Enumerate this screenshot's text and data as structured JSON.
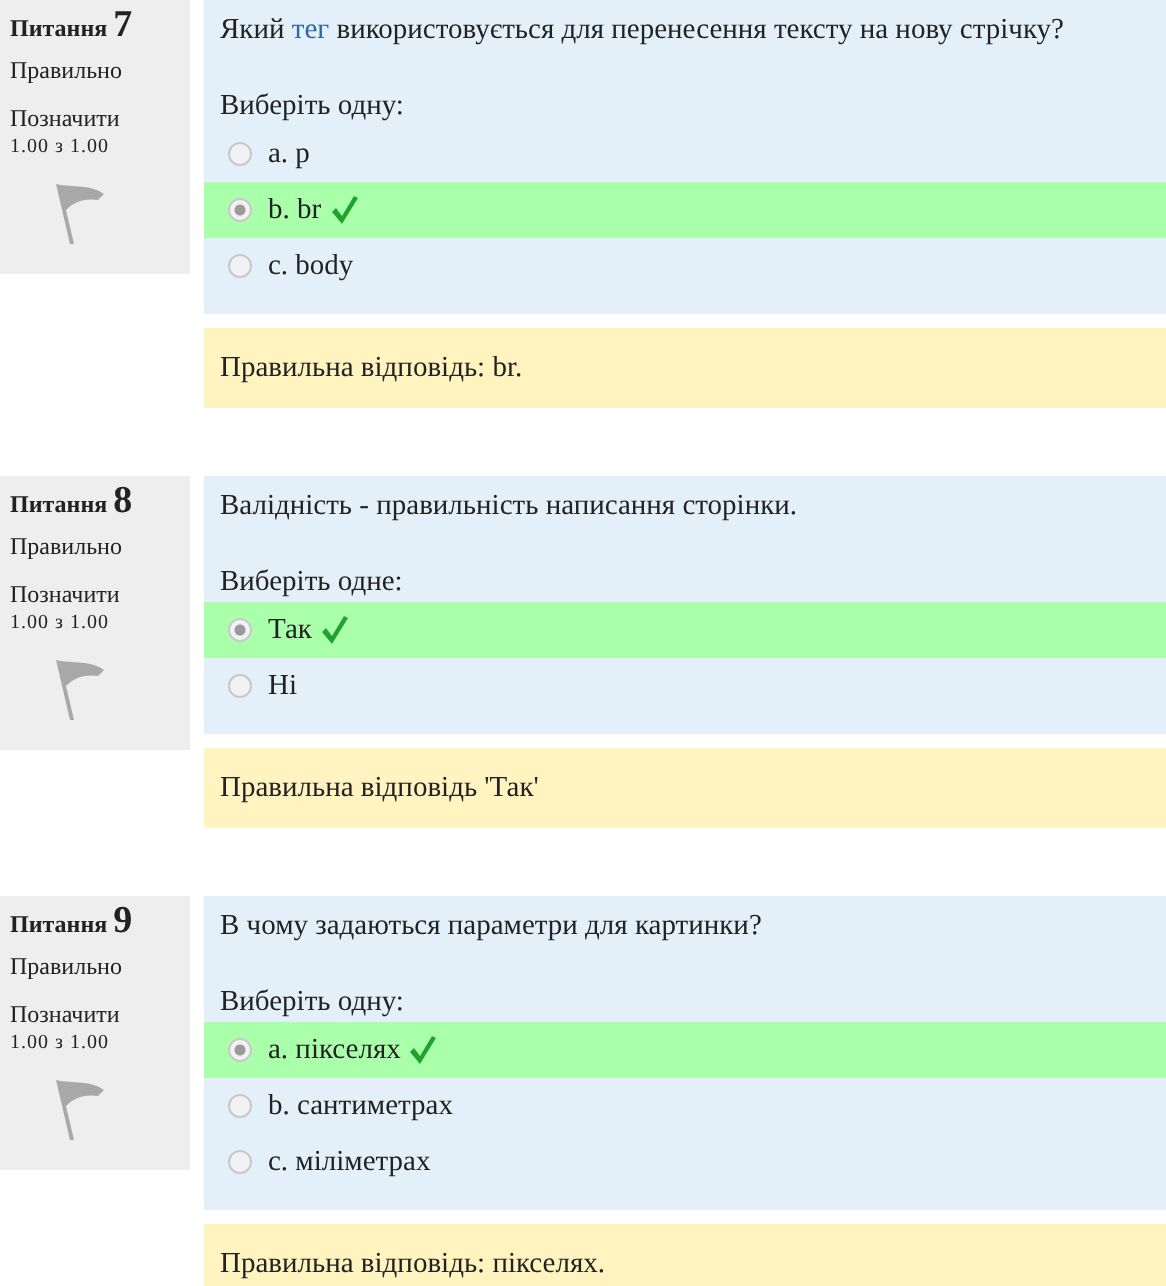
{
  "questions": [
    {
      "label": "Питання",
      "number": "7",
      "status": "Правильно",
      "flag_label": "Позначити",
      "score": "1.00 з 1.00",
      "flagged": false,
      "text": [
        {
          "kind": "plain",
          "text": "Який "
        },
        {
          "kind": "link",
          "text": "тег"
        },
        {
          "kind": "plain",
          "text": " використовується для перенесення тексту на нову стрічку?"
        }
      ],
      "prompt": "Виберіть одну:",
      "options": [
        {
          "text": "a. p",
          "selected": false,
          "correct": false
        },
        {
          "text": "b. br",
          "selected": true,
          "correct": true
        },
        {
          "text": "c. body",
          "selected": false,
          "correct": false
        }
      ],
      "feedback": "Правильна відповідь: br."
    },
    {
      "label": "Питання",
      "number": "8",
      "status": "Правильно",
      "flag_label": "Позначити",
      "score": "1.00 з 1.00",
      "flagged": false,
      "text": [
        {
          "kind": "plain",
          "text": "Валідність - правильність написання сторінки."
        }
      ],
      "prompt": "Виберіть одне:",
      "options": [
        {
          "text": "Так",
          "selected": true,
          "correct": true
        },
        {
          "text": "Ні",
          "selected": false,
          "correct": false
        }
      ],
      "feedback": "Правильна відповідь 'Так'"
    },
    {
      "label": "Питання",
      "number": "9",
      "status": "Правильно",
      "flag_label": "Позначити",
      "score": "1.00 з 1.00",
      "flagged": false,
      "text": [
        {
          "kind": "plain",
          "text": "В чому задаються параметри для картинки?"
        }
      ],
      "prompt": "Виберіть одну:",
      "options": [
        {
          "text": "a. пікселях",
          "selected": true,
          "correct": true
        },
        {
          "text": "b. сантиметрах",
          "selected": false,
          "correct": false
        },
        {
          "text": "c. міліметрах",
          "selected": false,
          "correct": false
        }
      ],
      "feedback": "Правильна відповідь: пікселях."
    }
  ]
}
